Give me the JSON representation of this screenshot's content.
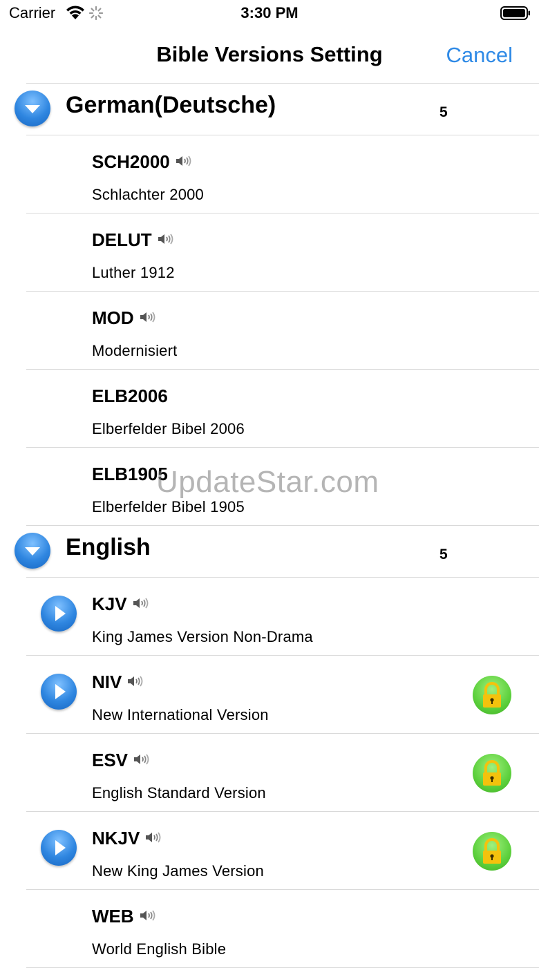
{
  "status_bar": {
    "carrier": "Carrier",
    "time": "3:30 PM"
  },
  "nav": {
    "title": "Bible Versions Setting",
    "cancel_label": "Cancel"
  },
  "sections": [
    {
      "title": "German(Deutsche)",
      "count": "5",
      "rows": [
        {
          "code": "SCH2000",
          "name": "Schlachter 2000",
          "audio": true,
          "play": false,
          "locked": false
        },
        {
          "code": "DELUT",
          "name": "Luther 1912",
          "audio": true,
          "play": false,
          "locked": false
        },
        {
          "code": "MOD",
          "name": "Modernisiert",
          "audio": true,
          "play": false,
          "locked": false
        },
        {
          "code": "ELB2006",
          "name": "Elberfelder Bibel 2006",
          "audio": false,
          "play": false,
          "locked": false
        },
        {
          "code": "ELB1905",
          "name": "Elberfelder Bibel 1905",
          "audio": false,
          "play": false,
          "locked": false
        }
      ]
    },
    {
      "title": "English",
      "count": "5",
      "rows": [
        {
          "code": "KJV",
          "name": "King James Version Non-Drama",
          "audio": true,
          "play": true,
          "locked": false
        },
        {
          "code": "NIV",
          "name": "New International Version",
          "audio": true,
          "play": true,
          "locked": true
        },
        {
          "code": "ESV",
          "name": "English Standard Version",
          "audio": true,
          "play": false,
          "locked": true
        },
        {
          "code": "NKJV",
          "name": "New King James Version",
          "audio": true,
          "play": true,
          "locked": true
        },
        {
          "code": "WEB",
          "name": "World English Bible",
          "audio": true,
          "play": false,
          "locked": false
        }
      ]
    }
  ],
  "watermark": "UpdateStar.com",
  "colors": {
    "accent": "#2f8ae6",
    "lock_green": "#5cd03c",
    "lock_yellow": "#f4c20d"
  },
  "icons": {
    "section_toggle": "chevron-down-icon",
    "play": "play-icon",
    "audio": "speaker-icon",
    "lock": "lock-icon"
  }
}
